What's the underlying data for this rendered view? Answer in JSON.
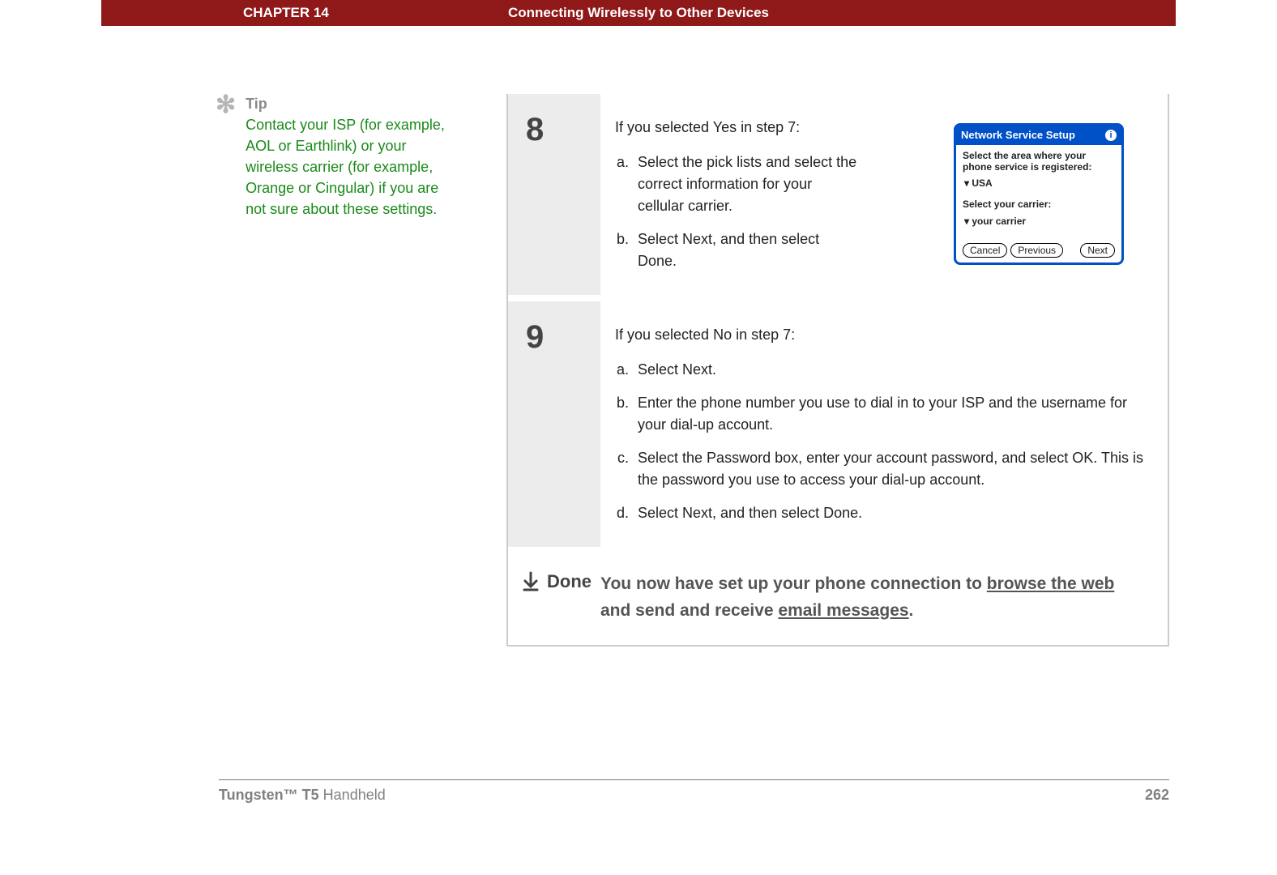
{
  "header": {
    "chapter": "CHAPTER 14",
    "title": "Connecting Wirelessly to Other Devices"
  },
  "tip": {
    "label": "Tip",
    "body": "Contact your ISP (for example, AOL or Earthlink) or your wireless carrier (for example, Orange or Cingular) if you are not sure about these settings."
  },
  "steps": {
    "8": {
      "num": "8",
      "intro": "If you selected Yes in step 7:",
      "items": [
        "Select the pick lists and select the correct information for your cellular carrier.",
        "Select Next, and then select Done."
      ]
    },
    "9": {
      "num": "9",
      "intro": "If you selected No in step 7:",
      "items": [
        "Select Next.",
        "Enter the phone number you use to dial in to your ISP and the username for your dial-up account.",
        "Select the Password box, enter your account password, and select OK. This is the password you use to access your dial-up account.",
        "Select Next, and then select Done."
      ]
    }
  },
  "device": {
    "title": "Network Service Setup",
    "areaLabel": "Select the area where your phone service is registered:",
    "area": "USA",
    "carrierLabel": "Select your carrier:",
    "carrier": "your carrier",
    "buttons": {
      "cancel": "Cancel",
      "previous": "Previous",
      "next": "Next"
    }
  },
  "done": {
    "label": "Done",
    "pre": "You now have set up your phone connection to ",
    "link1": "browse the web",
    "mid": " and send and receive ",
    "link2": "email messages",
    "post": "."
  },
  "footer": {
    "product_bold": "Tungsten™ T5",
    "product_rest": " Handheld",
    "page": "262"
  }
}
